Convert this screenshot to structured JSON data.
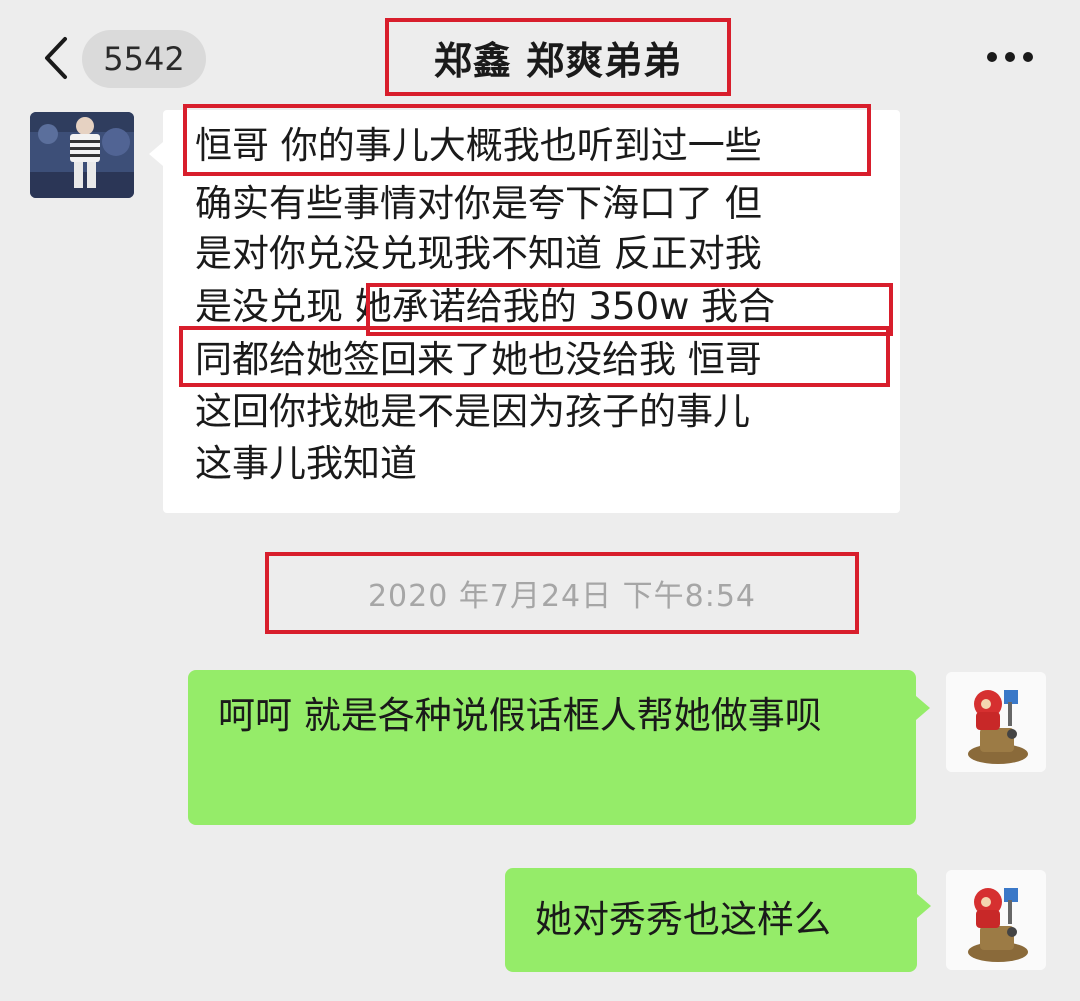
{
  "header": {
    "unread_count": "5542",
    "title": "郑鑫 郑爽弟弟"
  },
  "icons": {
    "back": "chevron-left-icon",
    "more": "more-dots-icon"
  },
  "incoming_message": {
    "lines": [
      "恒哥 你的事儿大概我也听到过一些",
      "确实有些事情对你是夸下海口了 但",
      "是对你兑没兑现我不知道 反正对我",
      "是没兑现 她承诺给我的 350w 我合",
      "同都给她签回来了她也没给我  恒哥",
      "这回你找她是不是因为孩子的事儿",
      "这事儿我知道"
    ]
  },
  "timestamp": "2020 年7月24日 下午8:54",
  "outgoing_messages": [
    "呵呵 就是各种说假话框人帮她做事呗",
    "她对秀秀也这样么"
  ],
  "colors": {
    "highlight": "#d81e2c",
    "outgoing_bubble": "#95ec69",
    "incoming_bubble": "#ffffff",
    "background": "#ededed"
  }
}
